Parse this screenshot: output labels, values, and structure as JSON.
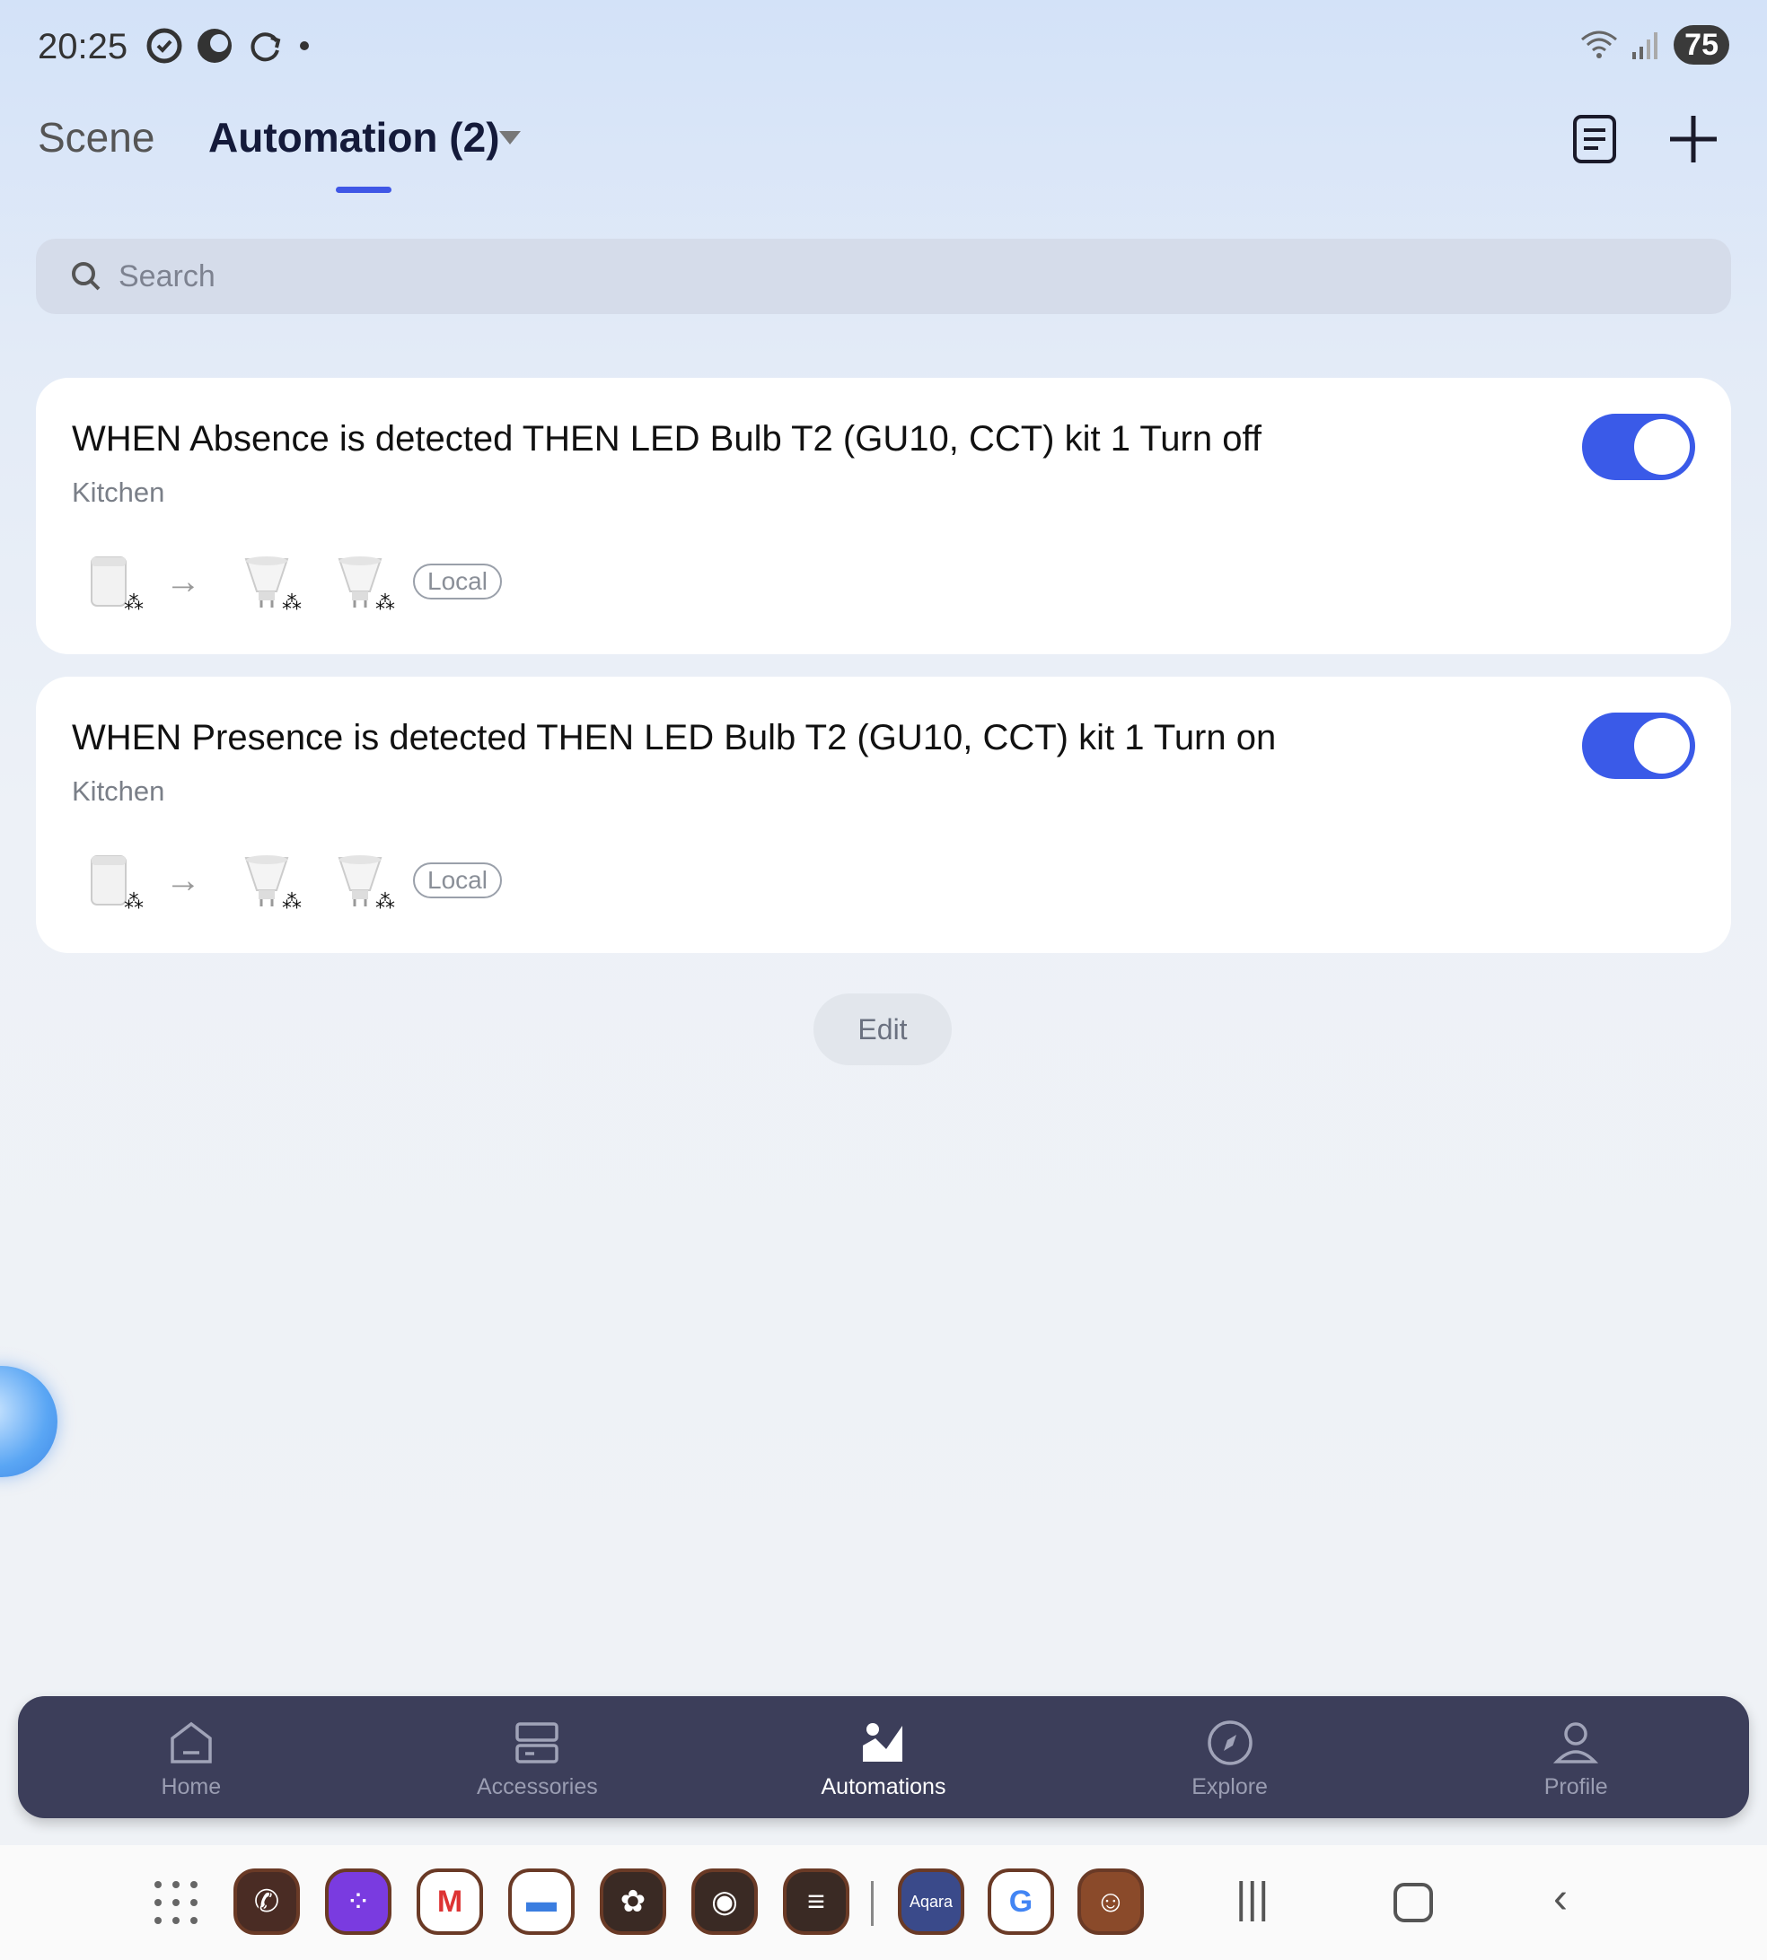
{
  "status_bar": {
    "time": "20:25",
    "battery": "75"
  },
  "header": {
    "tab_scene": "Scene",
    "tab_automation": "Automation (2)"
  },
  "search": {
    "placeholder": "Search"
  },
  "automations": [
    {
      "title": "WHEN Absence is detected THEN LED Bulb T2 (GU10, CCT) kit 1 Turn off",
      "room": "Kitchen",
      "enabled": true,
      "badge": "Local"
    },
    {
      "title": "WHEN Presence is detected THEN LED Bulb T2 (GU10, CCT) kit 1 Turn on",
      "room": "Kitchen",
      "enabled": true,
      "badge": "Local"
    }
  ],
  "edit_label": "Edit",
  "bottom_nav": {
    "items": [
      {
        "label": "Home",
        "icon": "home-icon"
      },
      {
        "label": "Accessories",
        "icon": "accessories-icon"
      },
      {
        "label": "Automations",
        "icon": "automations-icon",
        "active": true
      },
      {
        "label": "Explore",
        "icon": "compass-icon"
      },
      {
        "label": "Profile",
        "icon": "person-icon"
      }
    ]
  },
  "dock": {
    "aqara_label": "Aqara"
  },
  "colors": {
    "accent": "#3a5ae8",
    "nav_bg": "#3c3e5a",
    "tab_underline": "#3f57e6"
  }
}
